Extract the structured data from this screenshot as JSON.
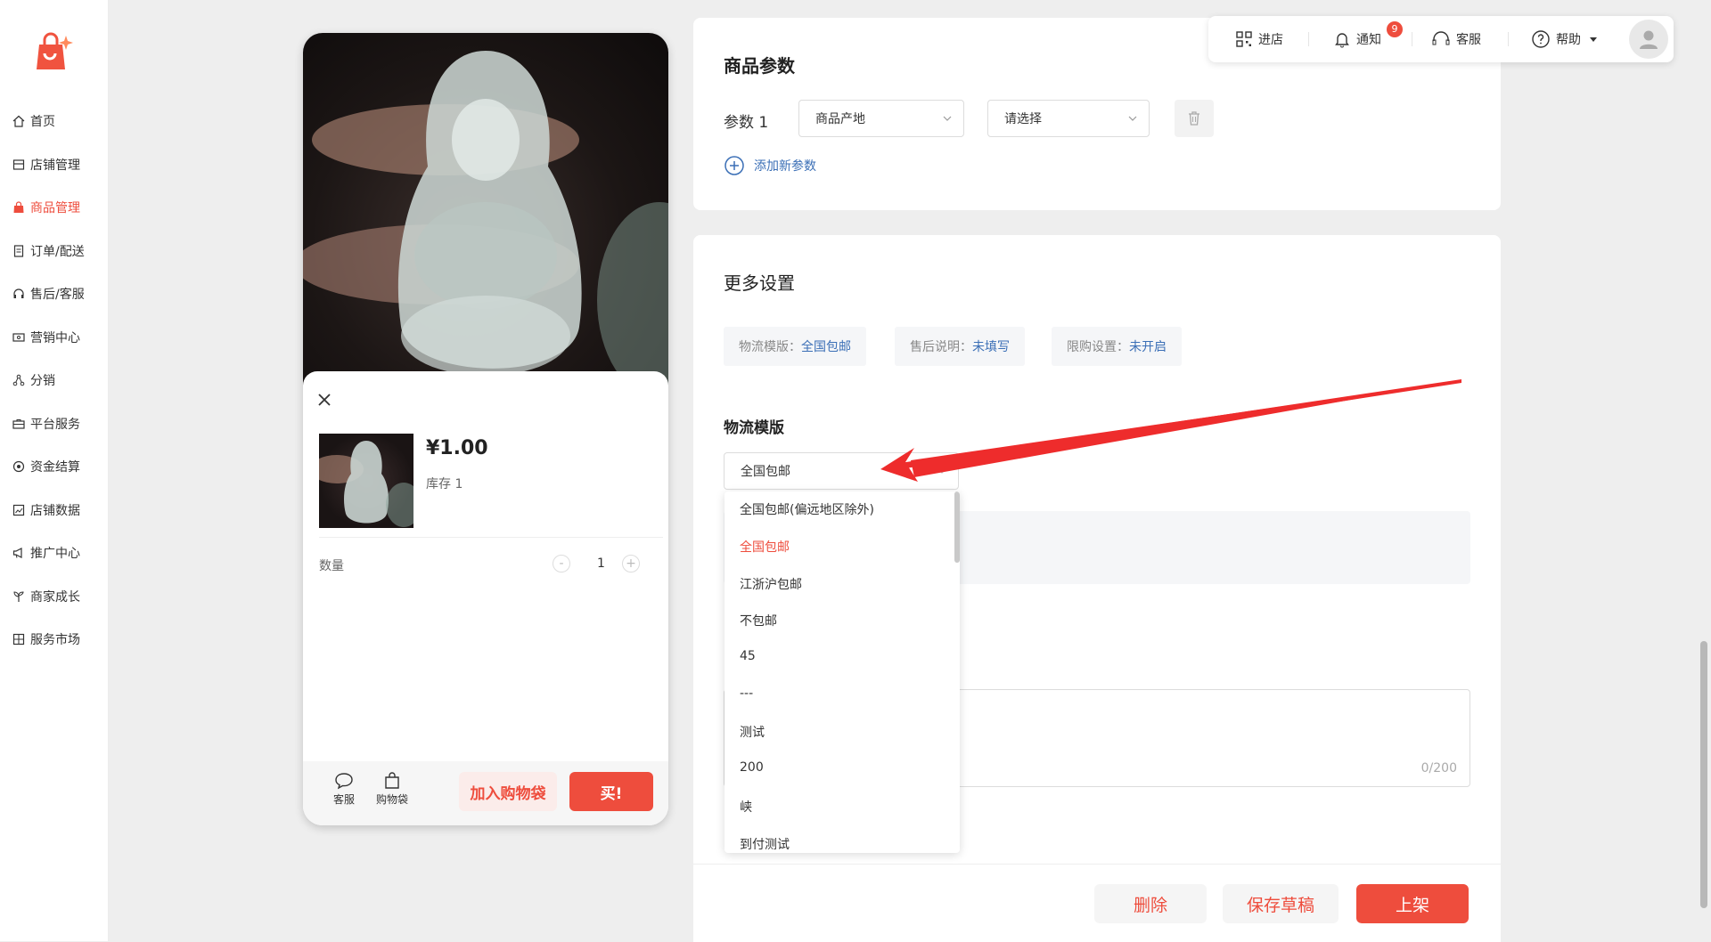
{
  "sidebar": {
    "items": [
      {
        "label": "首页",
        "icon": "home-icon"
      },
      {
        "label": "店铺管理",
        "icon": "shop-icon"
      },
      {
        "label": "商品管理",
        "icon": "bag-icon",
        "active": true
      },
      {
        "label": "订单/配送",
        "icon": "order-icon"
      },
      {
        "label": "售后/客服",
        "icon": "headset-icon"
      },
      {
        "label": "营销中心",
        "icon": "coupon-icon"
      },
      {
        "label": "分销",
        "icon": "share-icon"
      },
      {
        "label": "平台服务",
        "icon": "briefcase-icon"
      },
      {
        "label": "资金结算",
        "icon": "money-icon"
      },
      {
        "label": "店铺数据",
        "icon": "chart-icon"
      },
      {
        "label": "推广中心",
        "icon": "megaphone-icon"
      },
      {
        "label": "商家成长",
        "icon": "sprout-icon"
      },
      {
        "label": "服务市场",
        "icon": "market-icon"
      }
    ]
  },
  "preview": {
    "price": "¥1.00",
    "stock": "库存 1",
    "quantity_label": "数量",
    "quantity_value": "1",
    "minus": "-",
    "plus": "+",
    "service_label": "客服",
    "cart_label": "购物袋",
    "add_cart_label": "加入购物袋",
    "buy_label": "买!"
  },
  "params": {
    "title": "商品参数",
    "row_label": "参数 1",
    "select1_value": "商品产地",
    "select2_value": "请选择",
    "add_label": "添加新参数"
  },
  "more": {
    "title": "更多设置",
    "tags": [
      {
        "key": "物流模版：",
        "value": "全国包邮"
      },
      {
        "key": "售后说明：",
        "value": "未填写"
      },
      {
        "key": "限购设置：",
        "value": "未开启"
      }
    ],
    "logistics_title": "物流模版",
    "logistics_value": "全国包邮",
    "counter": "0/200"
  },
  "dropdown": {
    "options": [
      "全国包邮(偏远地区除外)",
      "全国包邮",
      "江浙沪包邮",
      "不包邮",
      "45",
      "---",
      "测试",
      "200",
      "峡",
      "到付测试"
    ],
    "selected": "全国包邮"
  },
  "topbar": {
    "enter_shop": "进店",
    "notify": "通知",
    "notify_count": "9",
    "service": "客服",
    "help": "帮助"
  },
  "actions": {
    "delete": "删除",
    "save_draft": "保存草稿",
    "publish": "上架"
  },
  "colors": {
    "accent": "#ee4d3d",
    "link": "#3b6fb6"
  }
}
